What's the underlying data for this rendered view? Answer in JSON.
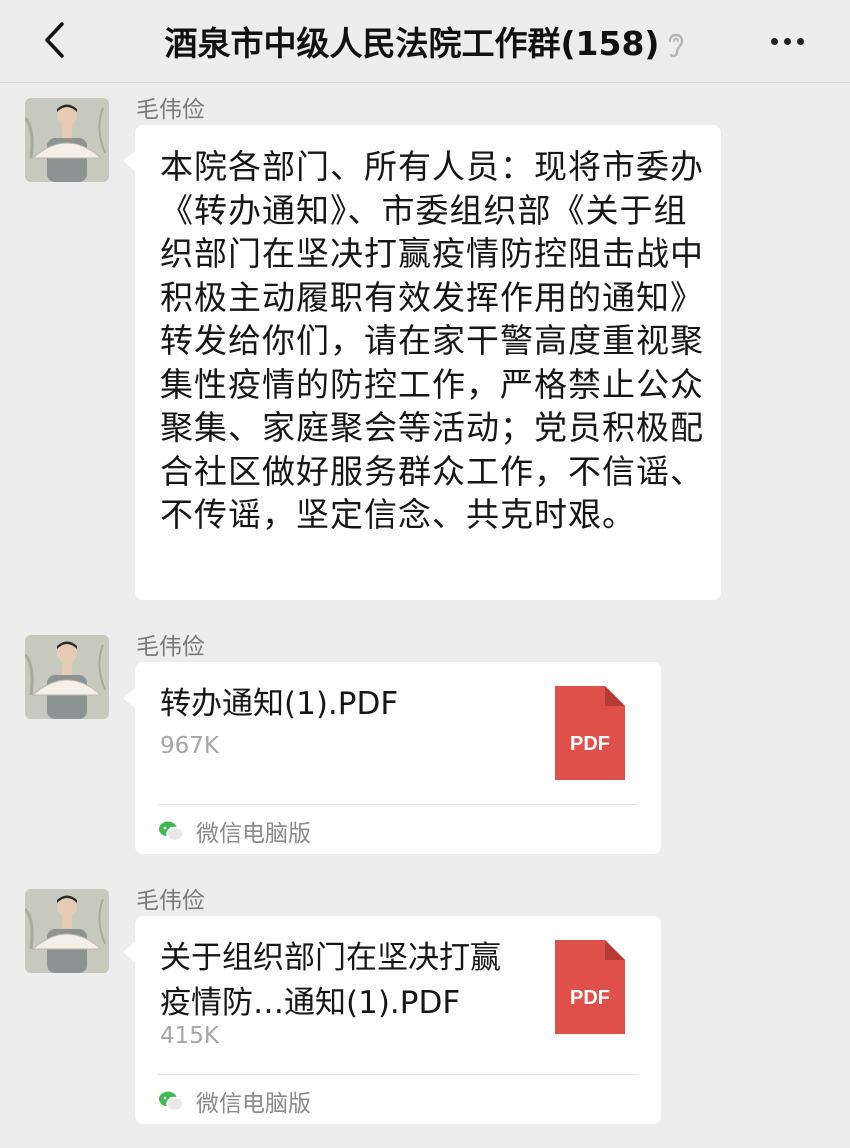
{
  "header": {
    "title": "酒泉市中级人民法院工作群(158)",
    "back_icon": "chevron-left-icon",
    "ear_icon": "ear-icon",
    "more_icon": "more-dots-icon"
  },
  "messages": [
    {
      "sender": "毛伟俭",
      "type": "text",
      "text": "本院各部门、所有人员：现将市委办《转办通知》、市委组织部《关于组织部门在坚决打赢疫情防控阻击战中积极主动履职有效发挥作用的通知》转发给你们，请在家干警高度重视聚集性疫情的防控工作，严格禁止公众聚集、家庭聚会等活动；党员积极配合社区做好服务群众工作，不信谣、不传谣，坚定信念、共克时艰。"
    },
    {
      "sender": "毛伟俭",
      "type": "file",
      "file_name": "转办通知(1).PDF",
      "file_size": "967K",
      "file_icon_label": "PDF",
      "source": "微信电脑版"
    },
    {
      "sender": "毛伟俭",
      "type": "file",
      "file_name": "关于组织部门在坚决打赢疫情防…通知(1).PDF",
      "file_size": "415K",
      "file_icon_label": "PDF",
      "source": "微信电脑版"
    }
  ],
  "colors": {
    "background": "#ededed",
    "bubble": "#ffffff",
    "pdf_red": "#e0504a",
    "wechat_green": "#3fb950"
  }
}
